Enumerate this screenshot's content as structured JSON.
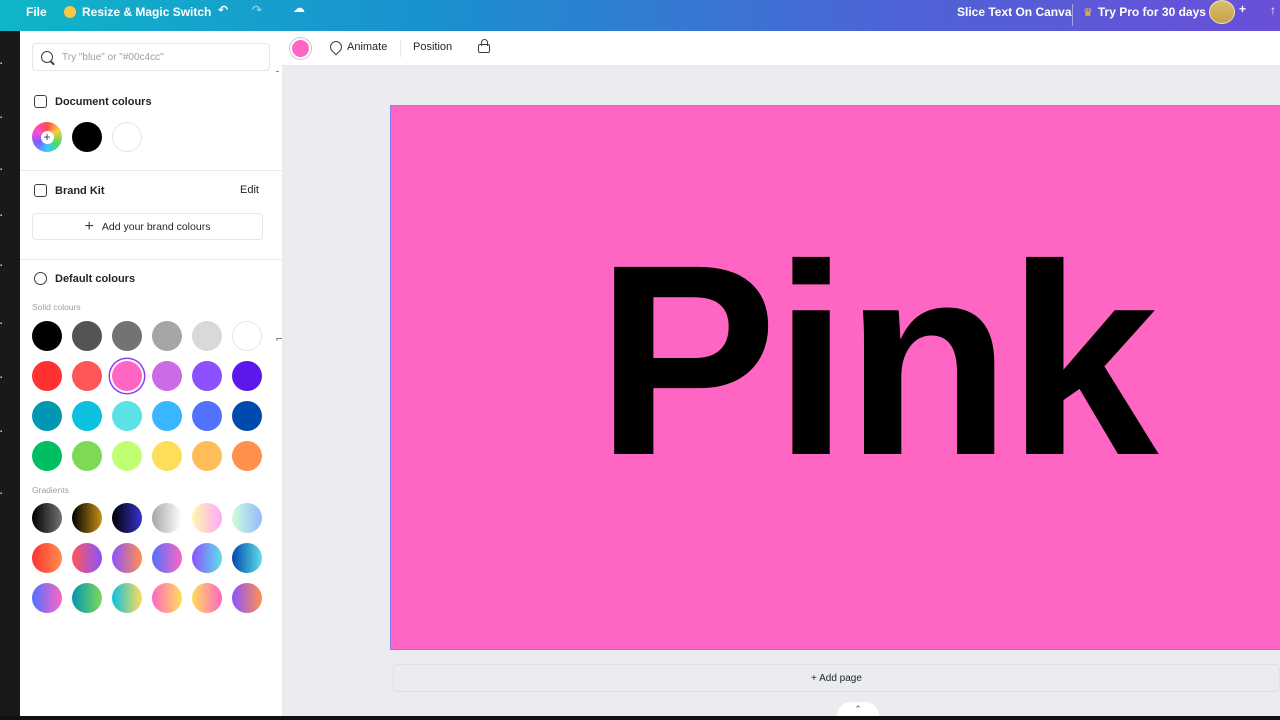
{
  "topbar": {
    "file_label": "File",
    "resize_label": "Resize & Magic Switch",
    "undo_icon": "undo-icon",
    "redo_icon": "redo-icon",
    "cloud_icon": "cloud-saved-icon",
    "doc_title": "Slice Text On Canva",
    "pro_label": "Try Pro for 30 days"
  },
  "panel": {
    "search_placeholder": "Try \"blue\" or \"#00c4cc\"",
    "document_colours_title": "Document colours",
    "document_colours": [
      "#000000",
      "#ffffff"
    ],
    "brand_kit_title": "Brand Kit",
    "brand_kit_edit": "Edit",
    "add_brand_label": "Add your brand colours",
    "default_colours_title": "Default colours",
    "solid_label": "Solid colours",
    "solid_colours": [
      [
        "#000000",
        "#545454",
        "#737373",
        "#a6a6a6",
        "#d9d9d9",
        "#ffffff"
      ],
      [
        "#ff3131",
        "#ff5757",
        "#ff66c4",
        "#cb6ce6",
        "#8c52ff",
        "#5e17eb"
      ],
      [
        "#0097b2",
        "#0cc0df",
        "#5ce1e6",
        "#38b6ff",
        "#5271ff",
        "#004aad"
      ],
      [
        "#00bf63",
        "#7ed957",
        "#c1ff72",
        "#ffde59",
        "#ffbd59",
        "#ff914d"
      ]
    ],
    "selected_colour": "#ff66c4",
    "gradients_label": "Gradients",
    "gradients": [
      [
        "linear-gradient(90deg,#000000,#737373)",
        "linear-gradient(90deg,#000000,#c89116)",
        "linear-gradient(90deg,#000000,#3533cd)",
        "linear-gradient(90deg,#a6a6a6,#ffffff)",
        "linear-gradient(90deg,#fff7ad,#ffa9f9)",
        "linear-gradient(90deg,#cdffd8,#94b9ff)"
      ],
      [
        "linear-gradient(90deg,#ff3131,#ff914d)",
        "linear-gradient(90deg,#ff5757,#8c52ff)",
        "linear-gradient(90deg,#8c52ff,#ff914d)",
        "linear-gradient(90deg,#5170ff,#ff66c4)",
        "linear-gradient(90deg,#8c52ff,#5ce1e6)",
        "linear-gradient(90deg,#004aad,#5de0e6)"
      ],
      [
        "linear-gradient(90deg,#5170ff,#ff66c4)",
        "linear-gradient(90deg,#0097b2,#7ed957)",
        "linear-gradient(90deg,#0cc0df,#ffde59)",
        "linear-gradient(90deg,#ff66c4,#ffde59)",
        "linear-gradient(90deg,#ffde59,#ff66c4)",
        "linear-gradient(90deg,#8c52ff,#ff914d)"
      ]
    ]
  },
  "context_toolbar": {
    "fill_colour": "#ff66c4",
    "animate_label": "Animate",
    "position_label": "Position",
    "lock_icon": "lock-icon"
  },
  "canvas": {
    "page_background": "#ff66c4",
    "page_text": "Pink",
    "add_page_label": "+ Add page"
  }
}
